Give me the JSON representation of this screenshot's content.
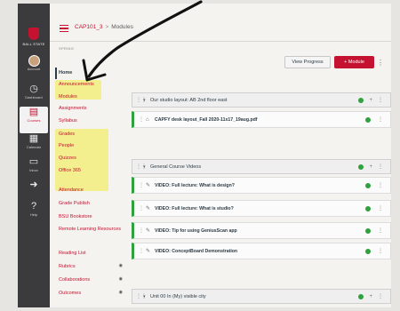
{
  "global_nav": {
    "logo_text": "BALL STATE",
    "items": [
      {
        "icon": "user-circle-icon",
        "label": "Account"
      },
      {
        "icon": "dashboard-icon",
        "label": "Dashboard"
      },
      {
        "icon": "book-icon",
        "label": "Courses"
      },
      {
        "icon": "calendar-icon",
        "label": "Calendar"
      },
      {
        "icon": "inbox-icon",
        "label": "Inbox"
      },
      {
        "icon": "arrow-right-icon",
        "label": ""
      },
      {
        "icon": "help-icon",
        "label": "Help"
      }
    ]
  },
  "header": {
    "course_code": "CAP101_3",
    "separator": ">",
    "page": "Modules"
  },
  "course_nav": {
    "caption": "SPRING",
    "items": [
      {
        "label": "Home",
        "active": true
      },
      {
        "label": "Announcements"
      },
      {
        "label": "Modules"
      },
      {
        "label": "Assignments"
      },
      {
        "label": "Syllabus"
      },
      {
        "label": "Grades"
      },
      {
        "label": "People"
      },
      {
        "label": "Quizzes"
      },
      {
        "label": "Office 365"
      },
      {
        "label": "Attendance"
      },
      {
        "label": "Grade Publish"
      },
      {
        "label": "BSU Bookstore"
      },
      {
        "label": "Remote Learning Resources"
      },
      {
        "label": "Reading List"
      },
      {
        "label": "Rubrics"
      },
      {
        "label": "Collaborations"
      },
      {
        "label": "Outcomes"
      }
    ]
  },
  "toolbar": {
    "view_progress": "View Progress",
    "add_module": "+ Module",
    "more": "⋮"
  },
  "modules": [
    {
      "title": "Our studio layout: AB 2nd floor east",
      "items": [
        "CAPFY desk layout_Fall 2020-11x17_19aug.pdf"
      ]
    },
    {
      "title": "General Course Videos",
      "items": [
        "VIDEO: Full lecture: What is design?",
        "VIDEO: Full lecture: What is studio?",
        "VIDEO: Tip for using GeniusScan app",
        "VIDEO: ConceptBoard Demonstration"
      ]
    },
    {
      "title": "Unit 00 In (My) visible city",
      "items": []
    }
  ],
  "colors": {
    "brand_red": "#c41230",
    "published_green": "#2fa13e",
    "highlight_yellow": "#f3ea3e",
    "nav_dark": "#3b3b3d"
  }
}
